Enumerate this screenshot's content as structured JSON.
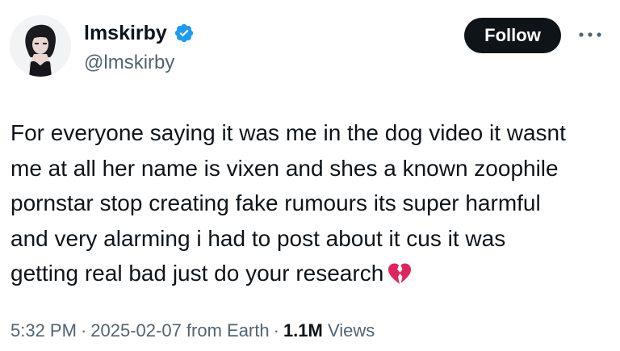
{
  "user": {
    "display_name": "lmskirby",
    "handle": "@lmskirby",
    "verified": true,
    "verified_color": "#1d9bf0",
    "avatar_icon": "avatar-image"
  },
  "actions": {
    "follow_label": "Follow",
    "more_icon": "more-horizontal-icon"
  },
  "tweet": {
    "text_lines": [
      "For everyone saying it was me in the dog video it wasnt",
      "me at all her name is vixen and shes a known zoophile",
      "pornstar stop creating fake rumours its super harmful",
      "and very alarming i had to post about it cus it was",
      "getting real bad just do your research"
    ],
    "emoji_icon": "broken-heart-icon"
  },
  "meta": {
    "time": "5:32 PM",
    "date": "2025-02-07 from Earth",
    "separator": "·",
    "views_count": "1.1M",
    "views_label": "Views"
  },
  "colors": {
    "text_primary": "#0f1419",
    "text_secondary": "#536471",
    "button_bg": "#0f1419",
    "button_text": "#ffffff",
    "heart": "#e0245e"
  }
}
